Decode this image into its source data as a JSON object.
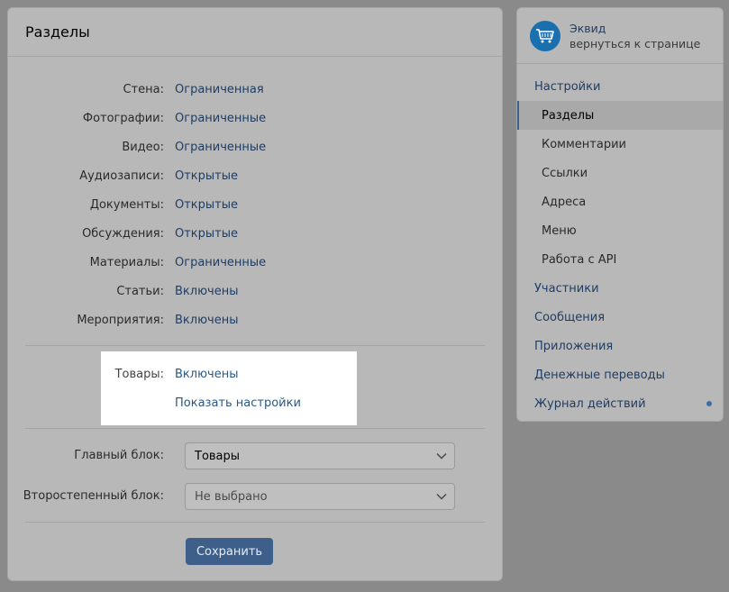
{
  "main": {
    "title": "Разделы",
    "sections": [
      {
        "label": "Стена:",
        "value": "Ограниченная"
      },
      {
        "label": "Фотографии:",
        "value": "Ограниченные"
      },
      {
        "label": "Видео:",
        "value": "Ограниченные"
      },
      {
        "label": "Аудиозаписи:",
        "value": "Открытые"
      },
      {
        "label": "Документы:",
        "value": "Открытые"
      },
      {
        "label": "Обсуждения:",
        "value": "Открытые"
      },
      {
        "label": "Материалы:",
        "value": "Ограниченные"
      },
      {
        "label": "Статьи:",
        "value": "Включены"
      },
      {
        "label": "Мероприятия:",
        "value": "Включены"
      }
    ],
    "goods": {
      "label": "Товары:",
      "value": "Включены",
      "settings_link": "Показать настройки"
    },
    "main_block": {
      "label": "Главный блок:",
      "value": "Товары"
    },
    "secondary_block": {
      "label": "Второстепенный блок:",
      "value": "Не выбрано"
    },
    "save_label": "Сохранить"
  },
  "sidebar": {
    "group_name": "Эквид",
    "back_link": "вернуться к странице",
    "items": [
      {
        "label": "Настройки",
        "level": "top"
      },
      {
        "label": "Разделы",
        "level": "sub",
        "active": true
      },
      {
        "label": "Комментарии",
        "level": "sub"
      },
      {
        "label": "Ссылки",
        "level": "sub"
      },
      {
        "label": "Адреса",
        "level": "sub"
      },
      {
        "label": "Меню",
        "level": "sub"
      },
      {
        "label": "Работа с API",
        "level": "sub"
      },
      {
        "label": "Участники",
        "level": "top"
      },
      {
        "label": "Сообщения",
        "level": "top"
      },
      {
        "label": "Приложения",
        "level": "top"
      },
      {
        "label": "Денежные переводы",
        "level": "top"
      },
      {
        "label": "Журнал действий",
        "level": "top",
        "has_dot": true
      }
    ]
  },
  "colors": {
    "accent": "#3e5f8a",
    "link": "#2a5885",
    "avatar": "#1a6fae"
  }
}
